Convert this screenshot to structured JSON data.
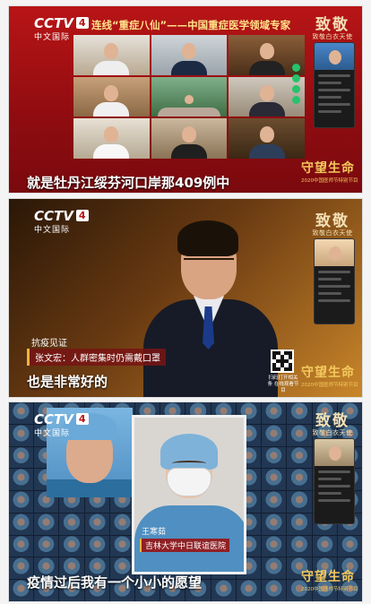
{
  "panels": [
    {
      "id": "p1",
      "channel_logo": "CCTV",
      "channel_num": "4",
      "channel_sub": "中文国际",
      "title": "连线“重症八仙”——中国重症医学领域专家",
      "caption": "就是牡丹江绥芬河口岸那409例中",
      "side_title": "致敬",
      "side_sub": "致敬白衣天使",
      "brand_big": "守望生命",
      "brand_small": "2020中国医师节特别节目"
    },
    {
      "id": "p2",
      "channel_logo": "CCTV",
      "channel_num": "4",
      "channel_sub": "中文国际",
      "tag_top": "抗疫见证",
      "tag_main": "张文宏：人群密集时仍需戴口罩",
      "caption": "也是非常好的",
      "qr_text": "扫码打开相关条 在线观看节目",
      "side_title": "致敬",
      "side_sub": "致敬白衣天使",
      "brand_big": "守望生命",
      "brand_small": "2020中国医师节特别节目"
    },
    {
      "id": "p3",
      "channel_logo": "CCTV",
      "channel_num": "4",
      "channel_sub": "中文国际",
      "person_name": "王寒茹",
      "person_hospital": "吉林大学中日联谊医院",
      "caption": "疫情过后我有一个小小的愿望",
      "side_title": "致敬",
      "side_sub": "致敬白衣天使",
      "brand_big": "守望生命",
      "brand_small": "2020中国医师节特别节目"
    }
  ],
  "colors": {
    "brand_red": "#b81516",
    "gold": "#f4c95d",
    "title_yellow": "#ffe38a"
  },
  "icons": [
    "cctv-logo",
    "qr-code",
    "phone-preview"
  ]
}
